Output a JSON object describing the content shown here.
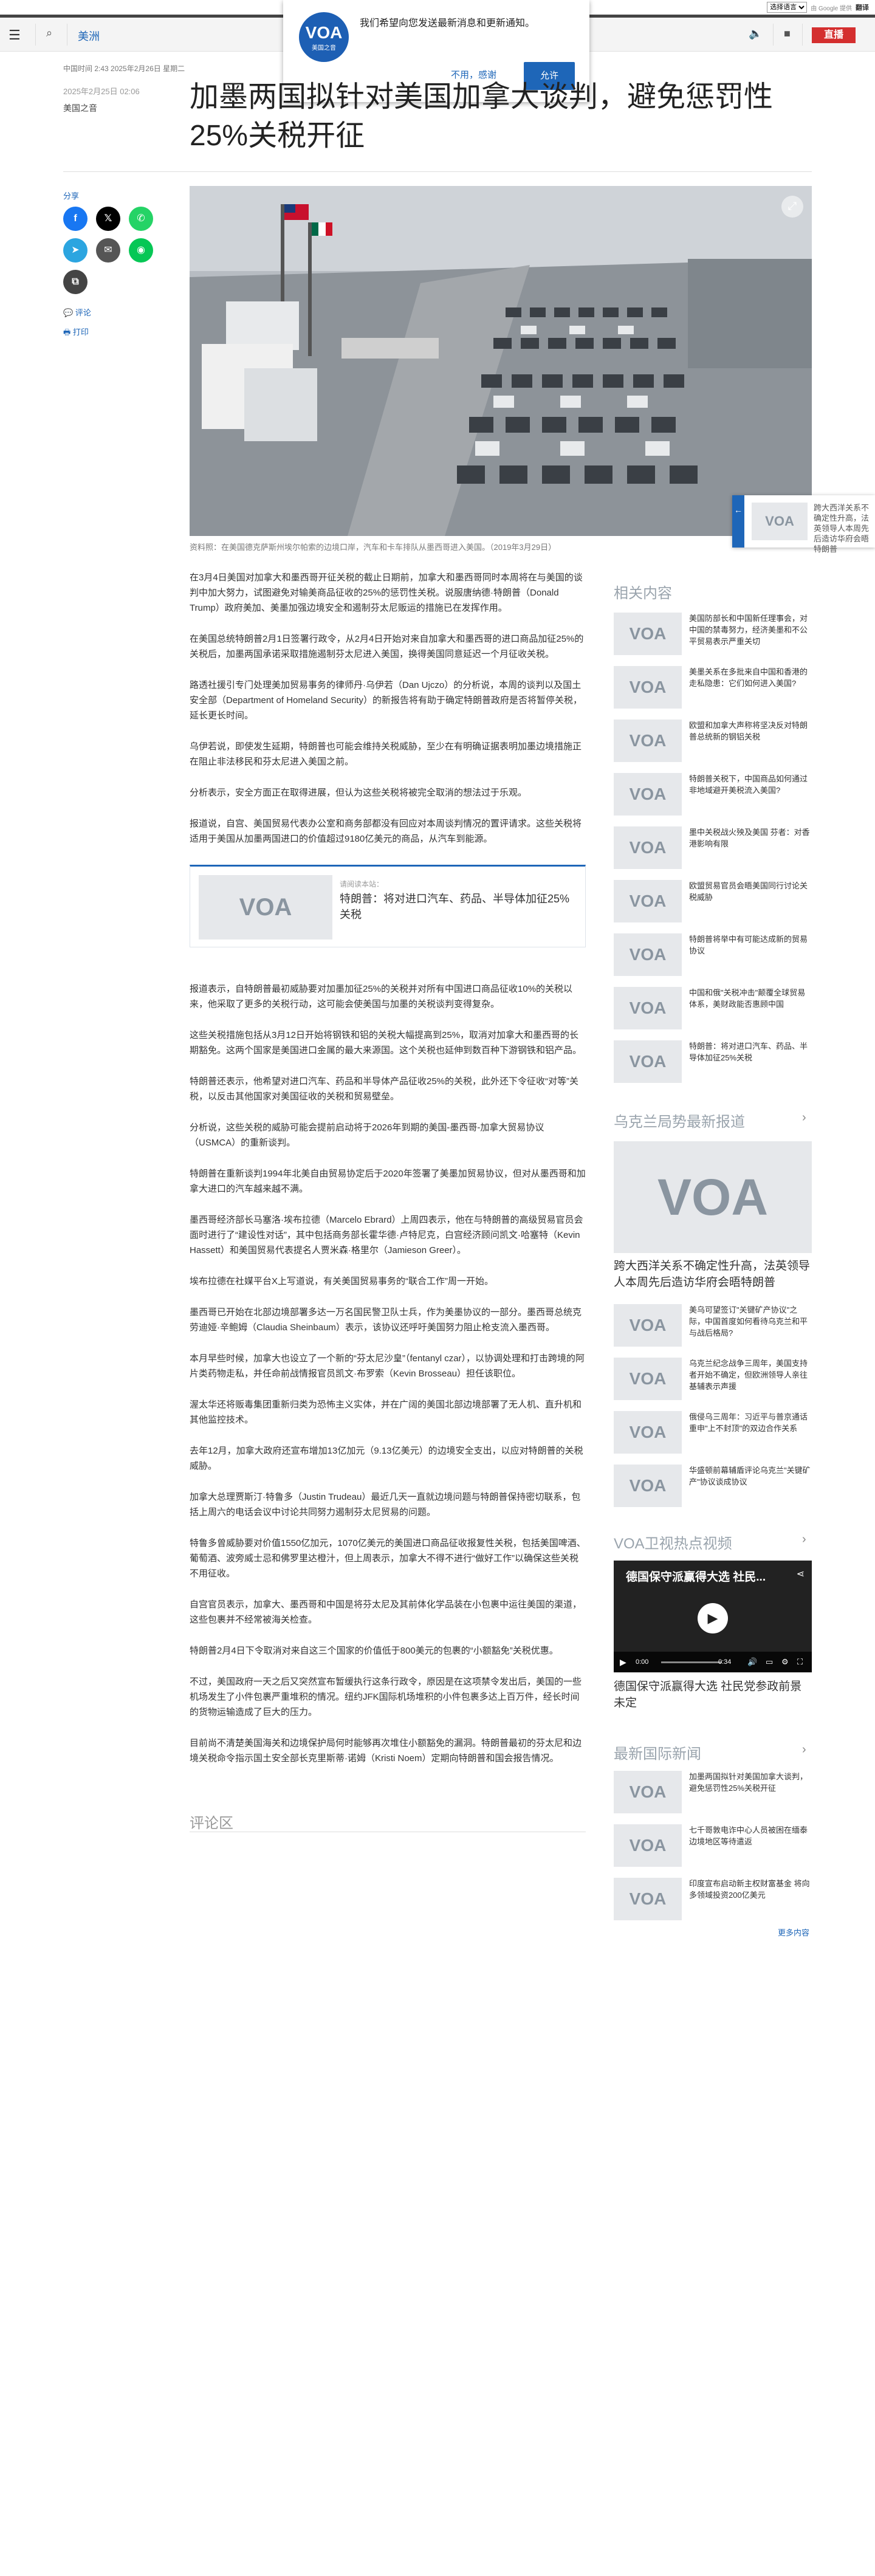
{
  "translate_bar": {
    "select": "选择语言",
    "powered": "由 Google 提供",
    "translate": "翻译"
  },
  "header": {
    "region": "美洲",
    "live": "直播"
  },
  "notification": {
    "message": "我们希望向您发送最新消息和更新通知。",
    "no": "不用，感谢",
    "yes": "允许",
    "logo": "VOA",
    "logo_sub": "美国之音"
  },
  "article": {
    "meta": "中国时间 2:43 2025年2月26日 星期二",
    "date": "2025年2月25日 02:06",
    "source": "美国之音",
    "title": "加墨两国拟针对美国加拿大谈判，避免惩罚性25%关税开征",
    "caption": "资料照：在美国德克萨斯州埃尔帕索的边境口岸，汽车和卡车排队从墨西哥进入美国。（2019年3月29日）",
    "paragraphs": [
      "在3月4日美国对加拿大和墨西哥开征关税的截止日期前，加拿大和墨西哥同时本周将在与美国的谈判中加大努力，试图避免对输美商品征收的25%的惩罚性关税。说服唐纳德·特朗普（Donald Trump）政府美加、美墨加强边境安全和遏制芬太尼贩运的措施已在发挥作用。",
      "在美国总统特朗普2月1日签署行政令，从2月4日开始对来自加拿大和墨西哥的进口商品加征25%的关税后，加墨两国承诺采取措施遏制芬太尼进入美国，换得美国同意延迟一个月征收关税。",
      "路透社援引专门处理美加贸易事务的律师丹·乌伊若（Dan Ujczo）的分析说，本周的谈判以及国土安全部（Department of Homeland Security）的新报告将有助于确定特朗普政府是否将暂停关税，延长更长时间。",
      "乌伊若说，即使发生延期，特朗普也可能会维持关税威胁，至少在有明确证据表明加墨边境措施正在阻止非法移民和芬太尼进入美国之前。",
      "分析表示，安全方面正在取得进展，但认为这些关税将被完全取消的想法过于乐观。",
      "报道说，自宫、美国贸易代表办公室和商务部都没有回应对本周谈判情况的置评请求。这些关税将适用于美国从加墨两国进口的价值超过9180亿美元的商品，从汽车到能源。",
      "报道表示，自特朗普最初威胁要对加墨加征25%的关税并对所有中国进口商品征收10%的关税以来，他采取了更多的关税行动，这可能会使美国与加墨的关税谈判变得复杂。",
      "这些关税措施包括从3月12日开始将钢铁和铝的关税大幅提高到25%，取消对加拿大和墨西哥的长期豁免。这两个国家是美国进口金属的最大来源国。这个关税也延伸到数百种下游钢铁和铝产品。",
      "特朗普还表示，他希望对进口汽车、药品和半导体产品征收25%的关税，此外还下令征收“对等”关税，以反击其他国家对美国征收的关税和贸易壁垒。",
      "分析说，这些关税的威胁可能会提前启动将于2026年到期的美国-墨西哥-加拿大贸易协议（USMCA）的重新谈判。",
      "特朗普在重新谈判1994年北美自由贸易协定后于2020年签署了美墨加贸易协议，但对从墨西哥和加拿大进口的汽车越来越不满。",
      "墨西哥经济部长马塞洛·埃布拉德（Marcelo Ebrard）上周四表示，他在与特朗普的高级贸易官员会面时进行了“建设性对话”，其中包括商务部长霍华德·卢特尼克，白宫经济顾问凯文·哈塞特（Kevin Hassett）和美国贸易代表提名人贾米森·格里尔（Jamieson Greer）。",
      "埃布拉德在社媒平台X上写道说，有关美国贸易事务的“联合工作”周一开始。",
      "墨西哥已开始在北部边境部署多达一万名国民警卫队士兵，作为美墨协议的一部分。墨西哥总统克劳迪娅·辛鲍姆（Claudia Sheinbaum）表示，该协议还呼吁美国努力阻止枪支流入墨西哥。",
      "本月早些时候，加拿大也设立了一个新的“芬太尼沙皇”（fentanyl czar），以协调处理和打击跨境的阿片类药物走私，并任命前战情报官员凯文·布罗索（Kevin Brosseau）担任该职位。",
      "渥太华还将贩毒集团重新归类为恐怖主义实体，并在广阔的美国北部边境部署了无人机、直升机和其他监控技术。",
      "去年12月，加拿大政府还宣布增加13亿加元（9.13亿美元）的边境安全支出，以应对特朗普的关税威胁。",
      "加拿大总理贾斯汀·特鲁多（Justin Trudeau）最近几天一直就边境问题与特朗普保持密切联系，包括上周六的电话会议中讨论共同努力遏制芬太尼贸易的问题。",
      "特鲁多曾威胁要对价值1550亿加元，1070亿美元的美国进口商品征收报复性关税，包括美国啤酒、葡萄酒、波旁威士忌和佛罗里达橙汁，但上周表示，加拿大不得不进行“做好工作”以确保这些关税不用征收。",
      "自宫官员表示，加拿大、墨西哥和中国是将芬太尼及其前体化学品装在小包裹中运往美国的渠道，这些包裹并不经常被海关检查。",
      "特朗普2月4日下令取消对来自这三个国家的价值低于800美元的包裹的“小额豁免”关税优惠。",
      "不过，美国政府一天之后又突然宣布暂缓执行这条行政令，原因是在这项禁令发出后，美国的一些机场发生了小件包裹严重堆积的情况。纽约JFK国际机场堆积的小件包裹多达上百万件，经长时间的货物运输造成了巨大的压力。",
      "目前尚不清楚美国海关和边境保护局何时能够再次堆住小额豁免的漏洞。特朗普最初的芬太尼和边境关税命令指示国土安全部长克里斯蒂·诺姆（Kristi Noem）定期向特朗普和国会报告情况。"
    ],
    "related_label": "请阅读本站：",
    "related_title": "特朗普：将对进口汽车、药品、半导体加征25%关税",
    "comments": "评论区"
  },
  "share": {
    "label": "分享",
    "comment": "评论",
    "print": "打印"
  },
  "floating": {
    "text": "跨大西洋关系不确定性升高，法英领导人本周先后造访华府会晤特朗普"
  },
  "sidebar": {
    "related_heading": "相关内容",
    "related": [
      "美国防部长和中国新任理事会，对中国的禁毒努力，经济美墨和不公平贸易表示严重关切",
      "美墨关系在多批来自中国和香港的走私隐患：它们如何进入美国?",
      "欧盟和加拿大声称将坚决反对特朗普总统新的钢铝关税",
      "特朗普关税下，中国商品如何通过非地域避开美税流入美国?",
      "墨中关税战火殃及美国 芬者：对香港影响有限",
      "欧盟贸易官员会晤美国同行讨论关税威胁",
      "特朗普将举中有可能达成新的贸易协议",
      "中国和俄\"关税冲击\"颠覆全球贸易体系，美财政能否惠顾中国",
      "特朗普：将对进口汽车、药品、半导体加征25%关税"
    ],
    "ukraine_heading": "乌克兰局势最新报道",
    "ukraine_feature": "跨大西洋关系不确定性升高，法英领导人本周先后造访华府会晤特朗普",
    "ukraine": [
      "美乌可望签订\"关键矿产协议\"之际，中国首度如何看待乌克兰和平与战后格局?",
      "乌克兰纪念战争三周年，美国支持者开始不确定，但欧洲领导人亲往基辅表示声援",
      "俄侵乌三周年：习近平与普京通话 重申\"上不封顶\"的双边合作关系",
      "华盛顿前幕辅盾评论乌克兰\"关键矿产\"协议谈成协议"
    ],
    "video_heading": "VOA卫视热点视频",
    "video_title": "德国保守派赢得大选 社民...",
    "video_caption": "德国保守派赢得大选 社民党参政前景未定",
    "video_time": "0:00",
    "video_dur": "0:34",
    "intl_heading": "最新国际新闻",
    "intl": [
      "加墨两国拟针对美国加拿大谈判，避免惩罚性25%关税开征",
      "七千哥敦电诈中心人员被困在缅泰边境地区等待遣返",
      "印度宣布启动新主权财富基金 将向多领域投资200亿美元"
    ],
    "more": "更多内容"
  },
  "colors": {
    "accent": "#1e66b8",
    "live": "#d42f2f"
  }
}
